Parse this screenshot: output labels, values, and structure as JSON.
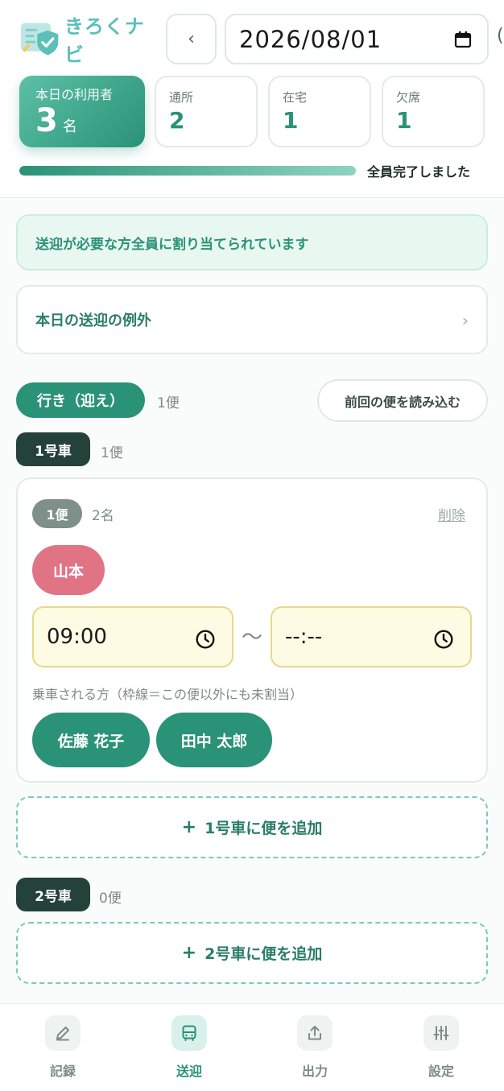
{
  "app": {
    "name": "きろくナビ"
  },
  "header": {
    "prev_label": "‹",
    "date_value": "2026/08/01",
    "edge_glyph": "("
  },
  "stats": {
    "main": {
      "label": "本日の利用者",
      "value": "3",
      "unit": "名"
    },
    "items": [
      {
        "label": "通所",
        "value": "2"
      },
      {
        "label": "在宅",
        "value": "1"
      },
      {
        "label": "欠席",
        "value": "1"
      }
    ]
  },
  "progress": {
    "percent": 100,
    "text": "全員完了しました"
  },
  "notice": {
    "text": "送迎が必要な方全員に割り当てられています"
  },
  "exception": {
    "label": "本日の送迎の例外",
    "chevron": "›"
  },
  "direction": {
    "label": "行き（迎え）",
    "count": "1便",
    "load_label": "前回の便を読み込む"
  },
  "vehicles": [
    {
      "tag": "1号車",
      "count": "1便",
      "trips": [
        {
          "tag": "1便",
          "people": "2名",
          "delete_label": "削除",
          "driver": "山本",
          "start_time": "09:00",
          "end_time": "--:--",
          "tilde": "〜",
          "riders_label": "乗車される方（枠線＝この便以外にも未割当）",
          "riders": [
            "佐藤 花子",
            "田中 太郎"
          ]
        }
      ],
      "add_label": "1号車に便を追加"
    },
    {
      "tag": "2号車",
      "count": "0便",
      "add_label": "2号車に便を追加"
    }
  ],
  "add_plus": "+",
  "tabs": [
    {
      "label": "記録",
      "icon": "pencil-icon"
    },
    {
      "label": "送迎",
      "icon": "bus-icon",
      "active": true
    },
    {
      "label": "出力",
      "icon": "upload-icon"
    },
    {
      "label": "設定",
      "icon": "sliders-icon"
    }
  ],
  "colors": {
    "accent": "#2a9276",
    "driver": "#e07485",
    "vehicle_tag": "#24413a",
    "time_bg": "#fdfbe4"
  }
}
